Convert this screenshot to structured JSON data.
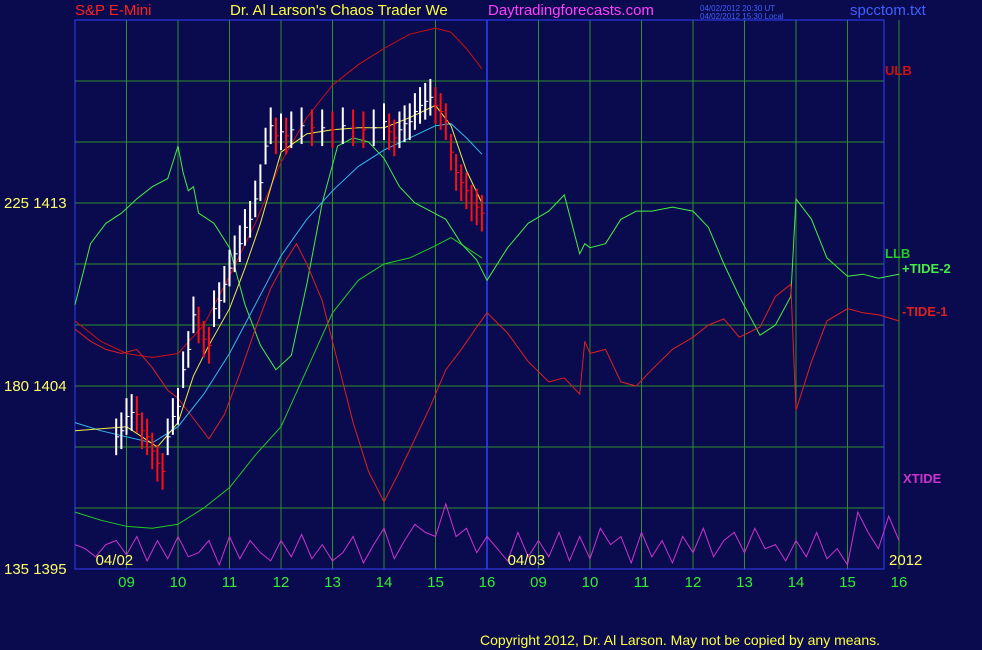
{
  "header": {
    "instrument": "S&P E-Mini",
    "title": "Dr. Al Larson's Chaos Trader We",
    "site": "Daytradingforecasts.com",
    "stamp_ut": "04/02/2012 20:30 UT",
    "stamp_local": "04/02/2012 15:30 Local",
    "filename": "spcctom.txt"
  },
  "footer": {
    "copyright": "Copyright 2012, Dr. Al Larson. May not be copied by any means."
  },
  "colors": {
    "background": "#0a0a4e",
    "grid": "#2f8f2f",
    "price_up": "#ffffff",
    "price_down": "#ff1010",
    "ulb": "#cc1111",
    "llb": "#22cc22",
    "tide2": "#44ee44",
    "tide1": "#dd2020",
    "xtide": "#cc33cc",
    "ma_fast": "#eeee44",
    "ma_slow": "#33bbee",
    "axis_text": "#ffff66"
  },
  "chart_data": {
    "type": "line",
    "y_ticks": [
      {
        "label": "225  1413",
        "value": 1413
      },
      {
        "label": "180  1404",
        "value": 1404
      },
      {
        "label": "135  1395",
        "value": 1395
      }
    ],
    "ylim": [
      1395,
      1422
    ],
    "x_hour_ticks": [
      "09",
      "10",
      "11",
      "12",
      "13",
      "14",
      "15",
      "16",
      "09",
      "10",
      "11",
      "12",
      "13",
      "14",
      "15",
      "16"
    ],
    "date_labels": [
      "04/02",
      "04/03"
    ],
    "year_label": "2012",
    "series_labels": [
      "ULB",
      "LLB",
      "+TIDE-2",
      "-TIDE-1",
      "XTIDE"
    ],
    "price": {
      "x": [
        8.8,
        8.9,
        9.0,
        9.1,
        9.2,
        9.3,
        9.4,
        9.5,
        9.6,
        9.7,
        9.8,
        9.9,
        10.0,
        10.1,
        10.2,
        10.3,
        10.4,
        10.5,
        10.6,
        10.7,
        10.8,
        10.9,
        11.0,
        11.1,
        11.2,
        11.3,
        11.4,
        11.5,
        11.6,
        11.7,
        11.8,
        11.9,
        12.0,
        12.1,
        12.2,
        12.4,
        12.6,
        12.8,
        13.0,
        13.2,
        13.4,
        13.6,
        13.8,
        14.0,
        14.1,
        14.2,
        14.3,
        14.4,
        14.5,
        14.6,
        14.7,
        14.8,
        14.9,
        15.0,
        15.1,
        15.2,
        15.3,
        15.4,
        15.5,
        15.6,
        15.7,
        15.8,
        15.9
      ],
      "y": [
        1401.5,
        1401.8,
        1402.5,
        1402.7,
        1402.6,
        1401.8,
        1401.5,
        1400.8,
        1400.2,
        1399.8,
        1401.5,
        1402.5,
        1403.0,
        1404.8,
        1405.8,
        1407.5,
        1407.0,
        1406.3,
        1406.0,
        1407.8,
        1408.2,
        1409.0,
        1409.8,
        1410.5,
        1411.0,
        1411.8,
        1412.2,
        1413.2,
        1414.0,
        1415.8,
        1416.8,
        1416.3,
        1416.5,
        1416.3,
        1416.6,
        1416.8,
        1416.7,
        1416.7,
        1416.6,
        1416.8,
        1416.7,
        1416.6,
        1416.7,
        1417.0,
        1416.5,
        1416.2,
        1416.6,
        1416.9,
        1417.0,
        1417.5,
        1417.8,
        1418.0,
        1418.2,
        1417.8,
        1417.5,
        1417.0,
        1415.5,
        1414.5,
        1414.0,
        1413.6,
        1413.0,
        1412.8,
        1412.5
      ],
      "bar_range": 0.9
    },
    "ulb": {
      "x": [
        8.0,
        8.5,
        9.0,
        9.5,
        10.0,
        10.5,
        11.0,
        11.5,
        12.0,
        12.5,
        13.0,
        13.5,
        14.0,
        14.5,
        15.0,
        15.3,
        15.6,
        15.9
      ],
      "y": [
        1407.2,
        1406.2,
        1405.6,
        1405.4,
        1405.6,
        1407.0,
        1409.4,
        1412.0,
        1415.0,
        1417.2,
        1418.8,
        1419.8,
        1420.6,
        1421.3,
        1421.6,
        1421.4,
        1420.6,
        1419.6
      ]
    },
    "llb": {
      "x": [
        8.0,
        8.5,
        9.0,
        9.5,
        10.0,
        10.5,
        11.0,
        11.5,
        12.0,
        12.5,
        13.0,
        13.5,
        14.0,
        14.5,
        15.0,
        15.3,
        15.6,
        15.9
      ],
      "y": [
        1397.8,
        1397.4,
        1397.1,
        1397.0,
        1397.2,
        1398.0,
        1399.0,
        1400.6,
        1402.0,
        1404.8,
        1407.6,
        1409.2,
        1410.0,
        1410.3,
        1410.9,
        1411.3,
        1410.8,
        1410.3
      ]
    },
    "ma_fast": {
      "x": [
        8.0,
        8.5,
        9.0,
        9.3,
        9.6,
        10.0,
        10.3,
        10.6,
        11.0,
        11.3,
        11.6,
        12.0,
        12.5,
        13.0,
        13.5,
        14.0,
        14.5,
        15.0,
        15.3,
        15.6,
        15.9
      ],
      "y": [
        1401.8,
        1401.9,
        1402.0,
        1401.5,
        1401.0,
        1402.2,
        1404.5,
        1406.0,
        1407.8,
        1409.8,
        1412.0,
        1415.5,
        1416.4,
        1416.6,
        1416.7,
        1416.7,
        1417.2,
        1417.8,
        1416.8,
        1414.6,
        1413.0
      ]
    },
    "ma_slow": {
      "x": [
        8.0,
        8.5,
        9.0,
        9.5,
        10.0,
        10.5,
        11.0,
        11.5,
        12.0,
        12.5,
        13.0,
        13.5,
        14.0,
        14.5,
        15.0,
        15.3,
        15.6,
        15.9
      ],
      "y": [
        1402.2,
        1401.8,
        1401.5,
        1401.2,
        1402.0,
        1403.6,
        1405.6,
        1408.0,
        1410.4,
        1412.2,
        1413.6,
        1414.8,
        1415.6,
        1416.2,
        1416.8,
        1416.9,
        1416.2,
        1415.4
      ]
    },
    "tide2": {
      "x": [
        8.0,
        8.3,
        8.6,
        8.9,
        9.2,
        9.5,
        9.8,
        10.0,
        10.1,
        10.2,
        10.3,
        10.4,
        10.7,
        11.0,
        11.3,
        11.6,
        11.9,
        12.2,
        12.5,
        12.8,
        13.1,
        13.4,
        13.7,
        14.0,
        14.3,
        14.6,
        14.9,
        15.2,
        15.5,
        15.8,
        16.0,
        16.4,
        16.8,
        17.2,
        17.5,
        17.8,
        17.9,
        18.0,
        18.3,
        18.6,
        18.9,
        19.2,
        19.6,
        20.0,
        20.3,
        20.6,
        20.9,
        21.3,
        21.6,
        21.9,
        22.0,
        22.3,
        22.6,
        23.0,
        23.3,
        23.6,
        24.0
      ],
      "y": [
        1408.0,
        1411.0,
        1412.0,
        1412.5,
        1413.2,
        1413.8,
        1414.2,
        1415.8,
        1414.5,
        1413.6,
        1413.8,
        1412.5,
        1412.0,
        1410.8,
        1408.0,
        1406.0,
        1404.8,
        1405.5,
        1409.0,
        1413.0,
        1415.8,
        1416.2,
        1416.0,
        1415.2,
        1413.8,
        1413.0,
        1412.6,
        1412.2,
        1411.0,
        1410.2,
        1409.2,
        1410.8,
        1412.0,
        1412.6,
        1413.4,
        1410.5,
        1411.0,
        1410.8,
        1411.0,
        1412.2,
        1412.6,
        1412.6,
        1412.8,
        1412.6,
        1411.8,
        1410.0,
        1408.4,
        1406.5,
        1407.0,
        1408.4,
        1413.2,
        1412.2,
        1410.3,
        1409.4,
        1409.5,
        1409.3,
        1409.5
      ]
    },
    "tide1": {
      "x": [
        8.0,
        8.3,
        8.6,
        8.9,
        9.2,
        9.5,
        9.8,
        10.0,
        10.3,
        10.6,
        10.9,
        11.2,
        11.5,
        11.8,
        12.1,
        12.3,
        12.5,
        12.8,
        13.1,
        13.4,
        13.7,
        14.0,
        14.3,
        14.6,
        14.9,
        15.2,
        15.5,
        15.8,
        16.0,
        16.4,
        16.8,
        17.2,
        17.5,
        17.8,
        17.9,
        18.0,
        18.3,
        18.6,
        18.9,
        19.2,
        19.6,
        20.0,
        20.3,
        20.6,
        20.9,
        21.3,
        21.6,
        21.9,
        22.0,
        22.3,
        22.6,
        23.0,
        23.3,
        23.6,
        24.0
      ],
      "y": [
        1406.8,
        1406.2,
        1405.8,
        1405.6,
        1405.8,
        1404.9,
        1403.8,
        1403.4,
        1402.4,
        1401.4,
        1402.6,
        1404.6,
        1406.8,
        1408.8,
        1410.2,
        1411.0,
        1410.0,
        1408.2,
        1405.2,
        1402.2,
        1399.8,
        1398.3,
        1399.8,
        1401.4,
        1403.0,
        1404.8,
        1405.8,
        1406.9,
        1407.6,
        1406.6,
        1405.2,
        1404.2,
        1404.4,
        1403.6,
        1406.2,
        1405.6,
        1405.8,
        1404.2,
        1404.0,
        1404.8,
        1405.8,
        1406.4,
        1407.0,
        1407.3,
        1406.4,
        1406.9,
        1408.4,
        1409.0,
        1402.8,
        1405.2,
        1407.2,
        1407.8,
        1407.6,
        1407.5,
        1407.2
      ]
    },
    "xtide": {
      "x": [
        8.0,
        8.2,
        8.4,
        8.6,
        8.8,
        9.0,
        9.2,
        9.4,
        9.6,
        9.8,
        10.0,
        10.2,
        10.4,
        10.6,
        10.8,
        11.0,
        11.2,
        11.4,
        11.6,
        11.8,
        12.0,
        12.2,
        12.4,
        12.6,
        12.8,
        13.0,
        13.2,
        13.4,
        13.6,
        13.8,
        14.0,
        14.2,
        14.4,
        14.6,
        14.8,
        15.0,
        15.2,
        15.4,
        15.6,
        15.8,
        16.0,
        16.2,
        16.4,
        16.6,
        16.8,
        17.0,
        17.2,
        17.4,
        17.6,
        17.8,
        18.0,
        18.2,
        18.4,
        18.6,
        18.8,
        19.0,
        19.2,
        19.4,
        19.6,
        19.8,
        20.0,
        20.2,
        20.4,
        20.6,
        20.8,
        21.0,
        21.2,
        21.4,
        21.6,
        21.8,
        22.0,
        22.2,
        22.4,
        22.6,
        22.8,
        23.0,
        23.2,
        23.4,
        23.6,
        23.8,
        24.0
      ],
      "y": [
        1396.2,
        1396.0,
        1395.6,
        1396.2,
        1396.4,
        1395.7,
        1396.6,
        1395.4,
        1396.4,
        1395.5,
        1396.6,
        1395.6,
        1395.8,
        1396.4,
        1395.2,
        1396.6,
        1395.5,
        1396.4,
        1395.8,
        1395.4,
        1396.4,
        1395.6,
        1396.7,
        1395.5,
        1396.2,
        1395.4,
        1395.8,
        1396.6,
        1395.3,
        1396.2,
        1397.0,
        1395.5,
        1396.4,
        1397.2,
        1396.8,
        1396.6,
        1398.2,
        1396.6,
        1397.0,
        1395.8,
        1396.6,
        1396.0,
        1395.4,
        1396.8,
        1395.6,
        1396.4,
        1395.6,
        1396.8,
        1395.4,
        1396.6,
        1395.5,
        1397.0,
        1396.2,
        1396.6,
        1395.3,
        1396.8,
        1395.6,
        1396.4,
        1395.3,
        1396.6,
        1395.8,
        1397.0,
        1395.6,
        1396.4,
        1396.8,
        1395.8,
        1397.0,
        1396.0,
        1396.2,
        1395.4,
        1396.4,
        1395.6,
        1396.8,
        1395.5,
        1396.0,
        1395.2,
        1397.8,
        1396.8,
        1396.0,
        1397.6,
        1396.4
      ]
    }
  }
}
